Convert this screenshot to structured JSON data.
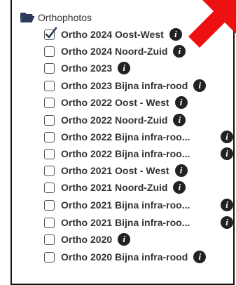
{
  "group": {
    "label": "Orthophotos",
    "icon": "folder-open-icon"
  },
  "layers": [
    {
      "label": "Ortho 2024 Oost-West",
      "checked": true
    },
    {
      "label": "Ortho 2024 Noord-Zuid",
      "checked": false
    },
    {
      "label": "Ortho 2023",
      "checked": false
    },
    {
      "label": "Ortho 2023 Bijna infra-rood",
      "checked": false
    },
    {
      "label": "Ortho 2022 Oost - West",
      "checked": false
    },
    {
      "label": "Ortho 2022 Noord-Zuid",
      "checked": false
    },
    {
      "label": "Ortho 2022 Bijna infra-roo...",
      "checked": false,
      "info_far": true
    },
    {
      "label": "Ortho 2022 Bijna infra-roo...",
      "checked": false,
      "info_far": true
    },
    {
      "label": "Ortho 2021 Oost - West",
      "checked": false
    },
    {
      "label": "Ortho 2021 Noord-Zuid",
      "checked": false
    },
    {
      "label": "Ortho 2021 Bijna infra-roo...",
      "checked": false,
      "info_far": true
    },
    {
      "label": "Ortho 2021 Bijna infra-roo...",
      "checked": false,
      "info_far": true
    },
    {
      "label": "Ortho 2020",
      "checked": false
    },
    {
      "label": "Ortho 2020 Bijna infra-rood",
      "checked": false
    }
  ],
  "info_icon": "info-icon",
  "colors": {
    "arrow": "#ee1111",
    "text": "#333333",
    "border": "#111111"
  }
}
